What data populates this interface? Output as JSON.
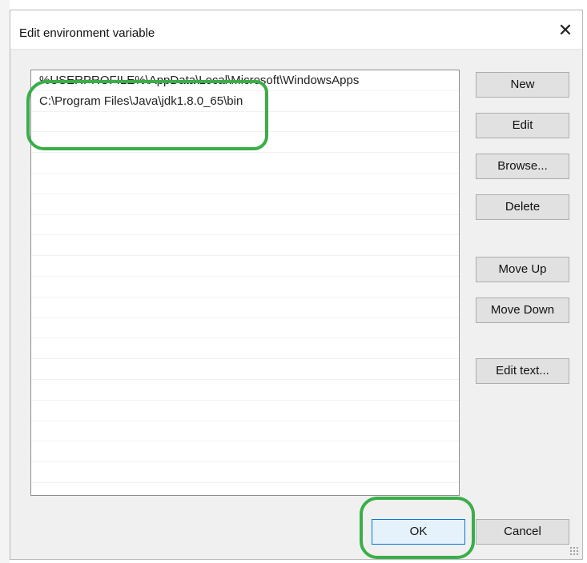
{
  "dialog": {
    "title": "Edit environment variable",
    "close_glyph": "✕"
  },
  "variable_list": {
    "items": [
      "%USERPROFILE%\\AppData\\Local\\Microsoft\\WindowsApps",
      "C:\\Program Files\\Java\\jdk1.8.0_65\\bin"
    ]
  },
  "buttons": {
    "new": "New",
    "edit": "Edit",
    "browse": "Browse...",
    "delete": "Delete",
    "move_up": "Move Up",
    "move_down": "Move Down",
    "edit_text": "Edit text...",
    "ok": "OK",
    "cancel": "Cancel"
  },
  "annotation": {
    "highlight_color": "#3aae49"
  }
}
